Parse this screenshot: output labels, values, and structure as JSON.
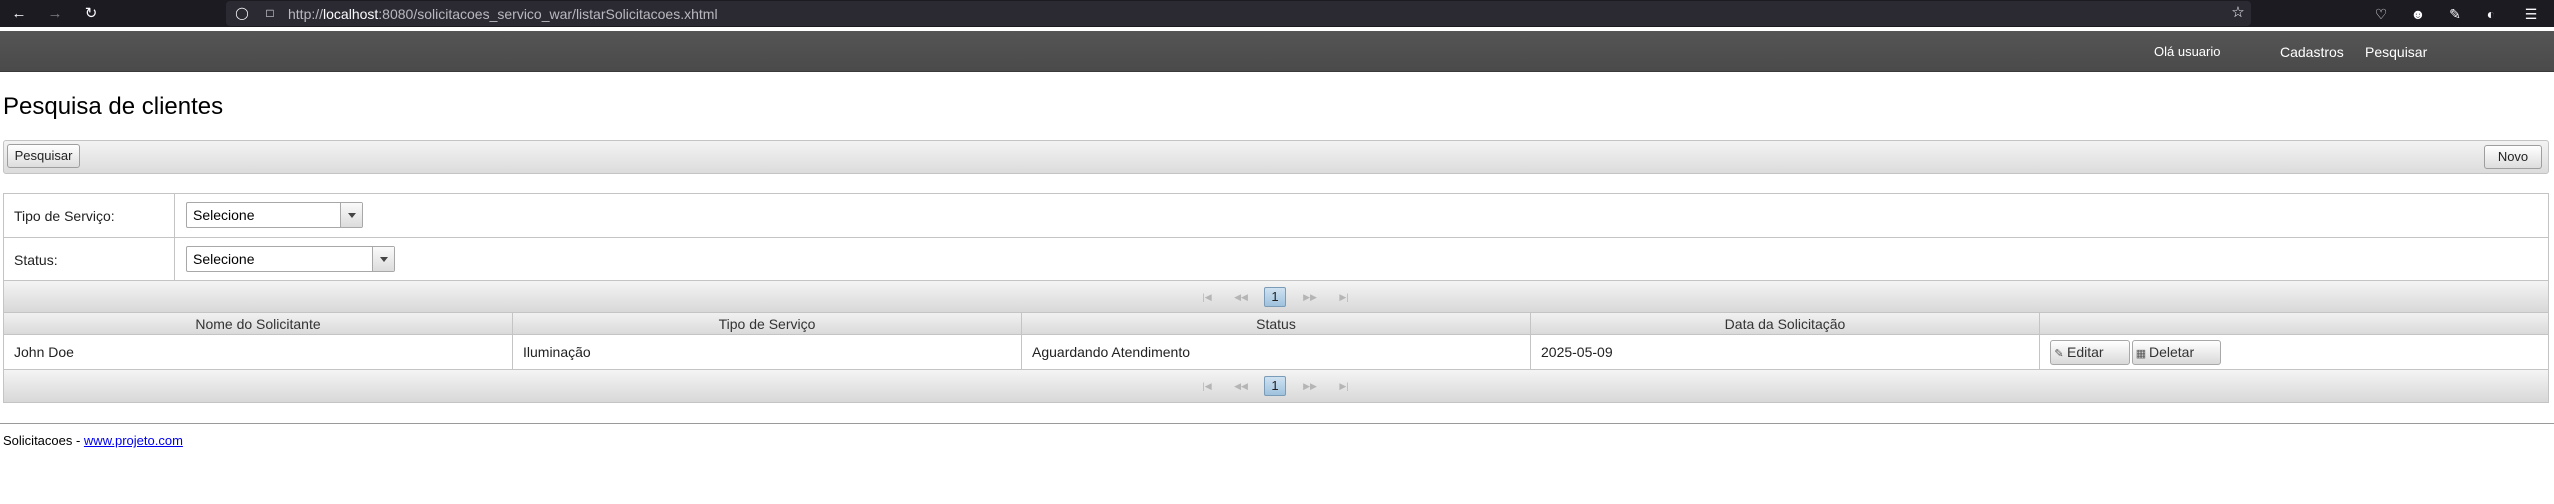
{
  "browser": {
    "url_prefix": "http://",
    "url_host": "localhost",
    "url_rest": ":8080/solicitacoes_servico_war/listarSolicitacoes.xhtml",
    "icons": [
      "back-icon",
      "forward-icon",
      "reload-icon",
      "shield-icon",
      "page-icon",
      "star-icon",
      "pocket-icon",
      "account-icon",
      "extensions-icon",
      "sync-icon",
      "menu-icon"
    ]
  },
  "header": {
    "greeting": "Olá usuario",
    "nav": {
      "cadastros": "Cadastros",
      "pesquisar": "Pesquisar"
    }
  },
  "page": {
    "title": "Pesquisa de clientes"
  },
  "toolbar": {
    "search_label": "Pesquisar",
    "new_label": "Novo"
  },
  "filters": {
    "tipo_label": "Tipo de Serviço:",
    "tipo_value": "Selecione",
    "status_label": "Status:",
    "status_value": "Selecione"
  },
  "paginator": {
    "current_page": "1"
  },
  "table": {
    "columns": [
      "Nome do Solicitante",
      "Tipo de Serviço",
      "Status",
      "Data da Solicitação",
      ""
    ],
    "rows": [
      {
        "nome": "John Doe",
        "tipo": "Iluminação",
        "status": "Aguardando Atendimento",
        "data": "2025-05-09"
      }
    ],
    "edit_label": "Editar",
    "delete_label": "Deletar"
  },
  "footer": {
    "text": "Solicitacoes - ",
    "link": "www.projeto.com"
  },
  "colors": {
    "header_bg": "#4f4f4f",
    "browser_bg": "#1c1b22",
    "active_page": "#a8c8e2"
  }
}
